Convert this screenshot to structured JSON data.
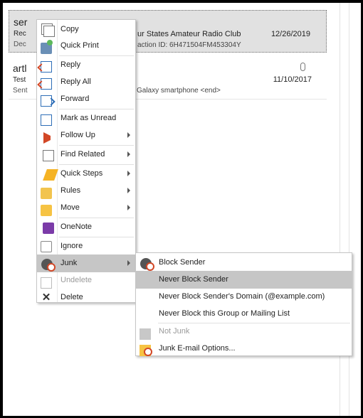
{
  "messages": [
    {
      "from": "ser",
      "subject": "Rec",
      "preview": "Dec",
      "subject_cont": "ur States Amateur Radio Club",
      "preview_cont": "action ID: 6H471504FM453304Y",
      "date": "12/26/2019"
    },
    {
      "from": "artl",
      "subject": "Test",
      "preview": "Sent",
      "subject_cont": "",
      "preview_cont": "Galaxy smartphone <end>",
      "date": "11/10/2017"
    }
  ],
  "context_menu": {
    "items": [
      {
        "label": "Copy",
        "icon": "copy-icon"
      },
      {
        "label": "Quick Print",
        "icon": "print-icon"
      },
      {
        "label": "Reply",
        "icon": "reply-icon"
      },
      {
        "label": "Reply All",
        "icon": "reply-all-icon"
      },
      {
        "label": "Forward",
        "icon": "forward-icon"
      },
      {
        "label": "Mark as Unread",
        "icon": "mark-unread-icon"
      },
      {
        "label": "Follow Up",
        "icon": "flag-icon"
      },
      {
        "label": "Find Related",
        "icon": "find-related-icon"
      },
      {
        "label": "Quick Steps",
        "icon": "lightning-icon"
      },
      {
        "label": "Rules",
        "icon": "rules-icon"
      },
      {
        "label": "Move",
        "icon": "folder-icon"
      },
      {
        "label": "OneNote",
        "icon": "onenote-icon"
      },
      {
        "label": "Ignore",
        "icon": "ignore-icon"
      },
      {
        "label": "Junk",
        "icon": "junk-icon"
      },
      {
        "label": "Undelete",
        "icon": "undelete-icon"
      },
      {
        "label": "Delete",
        "icon": "delete-icon"
      }
    ]
  },
  "junk_submenu": {
    "items": [
      {
        "label": "Block Sender",
        "icon": "block-sender-icon"
      },
      {
        "label": "Never Block Sender"
      },
      {
        "label": "Never Block Sender's Domain (@example.com)"
      },
      {
        "label": "Never Block this Group or Mailing List"
      },
      {
        "label": "Not Junk",
        "icon": "not-junk-icon"
      },
      {
        "label": "Junk E-mail Options...",
        "icon": "junk-options-icon"
      }
    ]
  },
  "colors": {
    "highlight": "#c6c6c6",
    "selected_message": "#e1e1e1",
    "accent_blue": "#2e6eb7",
    "accent_red": "#d24726"
  }
}
